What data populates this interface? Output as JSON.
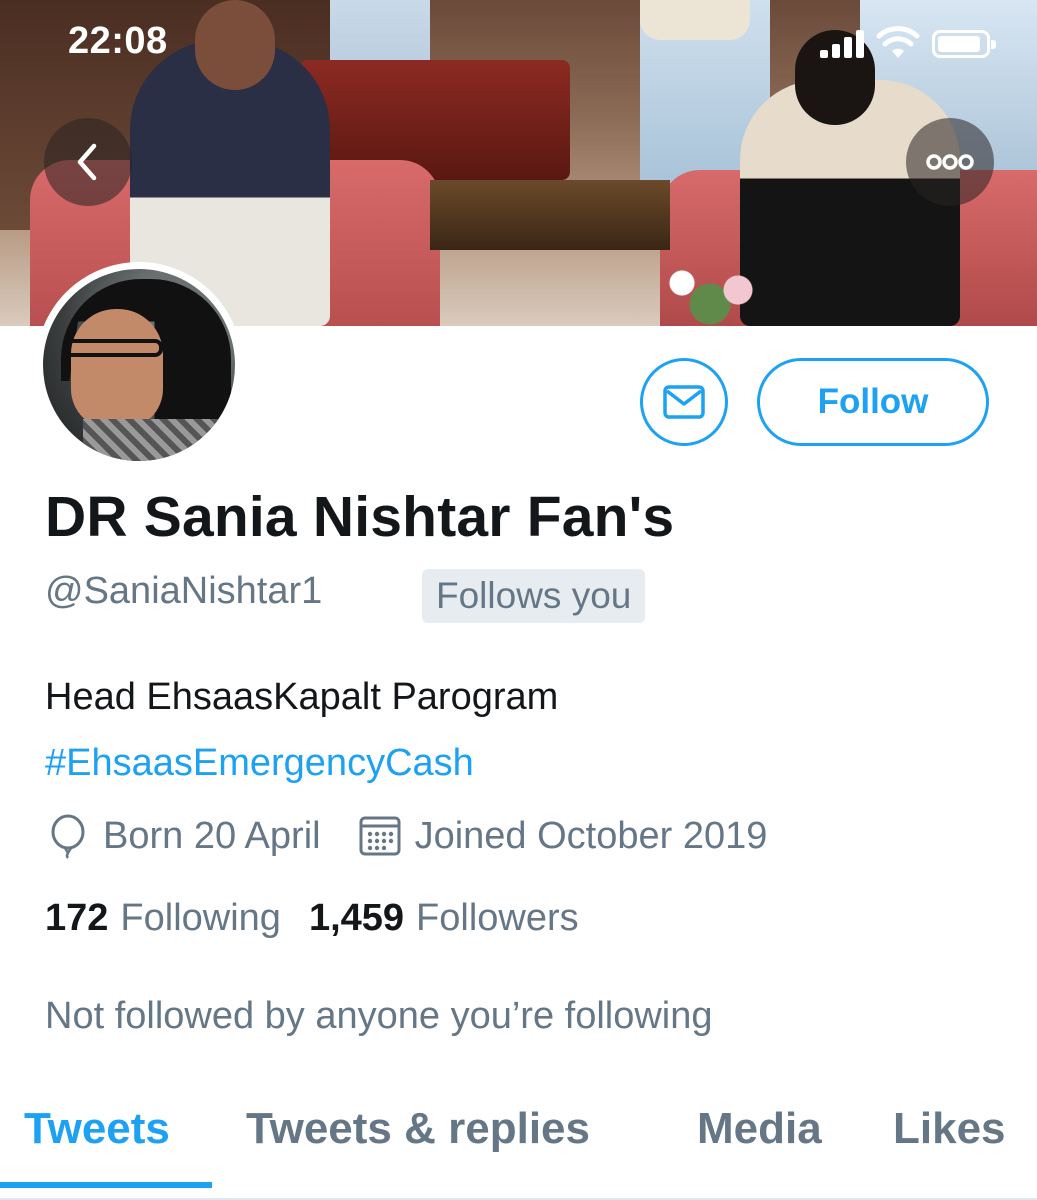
{
  "status_bar": {
    "time": "22:08",
    "icons": [
      "signal-icon",
      "wifi-icon",
      "battery-icon"
    ]
  },
  "header": {
    "back_icon": "chevron-left-icon",
    "more_icon": "more-horizontal-icon"
  },
  "profile": {
    "display_name": "DR Sania Nishtar Fan's",
    "handle": "@SaniaNishtar1",
    "follows_you_badge": "Follows you",
    "bio_line1": "Head EhsaasKapalt Parogram",
    "bio_hashtag": "#EhsaasEmergencyCash",
    "born": "Born 20 April",
    "joined": "Joined October 2019",
    "following_count": "172",
    "following_label": "Following",
    "followers_count": "1,459",
    "followers_label": "Followers",
    "mutuals_note": "Not followed by anyone you’re following"
  },
  "actions": {
    "message_icon": "envelope-icon",
    "follow_label": "Follow"
  },
  "tabs": [
    {
      "label": "Tweets",
      "active": true
    },
    {
      "label": "Tweets & replies",
      "active": false
    },
    {
      "label": "Media",
      "active": false
    },
    {
      "label": "Likes",
      "active": false
    }
  ],
  "colors": {
    "accent": "#1da1f2",
    "text_primary": "#14171a",
    "text_secondary": "#657786",
    "badge_bg": "#e6ecf0"
  }
}
